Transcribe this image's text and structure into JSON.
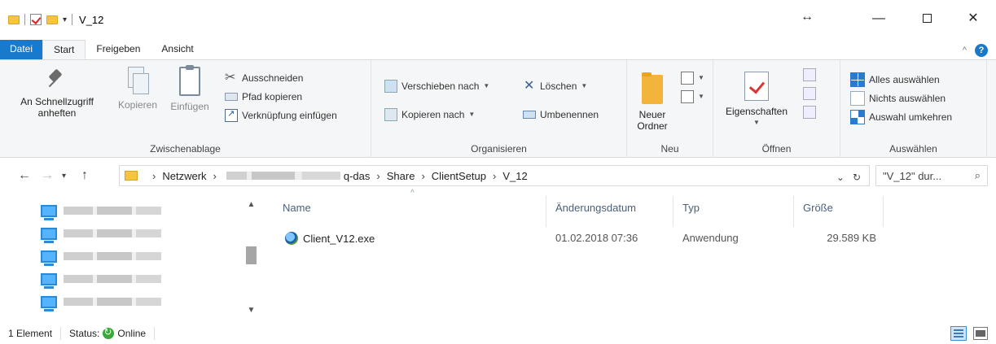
{
  "window": {
    "title": "V_12",
    "controls": {
      "minimize": "—",
      "close": "✕"
    }
  },
  "ribbon_tabs": [
    "Datei",
    "Start",
    "Freigeben",
    "Ansicht"
  ],
  "ribbon": {
    "clipboard": {
      "group_label": "Zwischenablage",
      "pin_line1": "An Schnellzugriff",
      "pin_line2": "anheften",
      "copy": "Kopieren",
      "paste": "Einfügen",
      "cut": "Ausschneiden",
      "copy_path": "Pfad kopieren",
      "paste_shortcut": "Verknüpfung einfügen"
    },
    "organize": {
      "group_label": "Organisieren",
      "move_to": "Verschieben nach",
      "copy_to": "Kopieren nach",
      "delete": "Löschen",
      "rename": "Umbenennen"
    },
    "new": {
      "group_label": "Neu",
      "new_folder_line1": "Neuer",
      "new_folder_line2": "Ordner"
    },
    "open": {
      "group_label": "Öffnen",
      "properties": "Eigenschaften"
    },
    "select": {
      "group_label": "Auswählen",
      "select_all": "Alles auswählen",
      "select_none": "Nichts auswählen",
      "invert_selection": "Auswahl umkehren"
    }
  },
  "address": {
    "crumbs": [
      "Netzwerk",
      "q-das",
      "Share",
      "ClientSetup",
      "V_12"
    ],
    "search_placeholder": "\"V_12\" dur..."
  },
  "columns": {
    "name": "Name",
    "modified": "Änderungsdatum",
    "type": "Typ",
    "size": "Größe"
  },
  "files": [
    {
      "name": "Client_V12.exe",
      "modified": "01.02.2018 07:36",
      "type": "Anwendung",
      "size": "29.589 KB"
    }
  ],
  "status": {
    "count": "1 Element",
    "status_label": "Status:",
    "status_value": "Online"
  }
}
